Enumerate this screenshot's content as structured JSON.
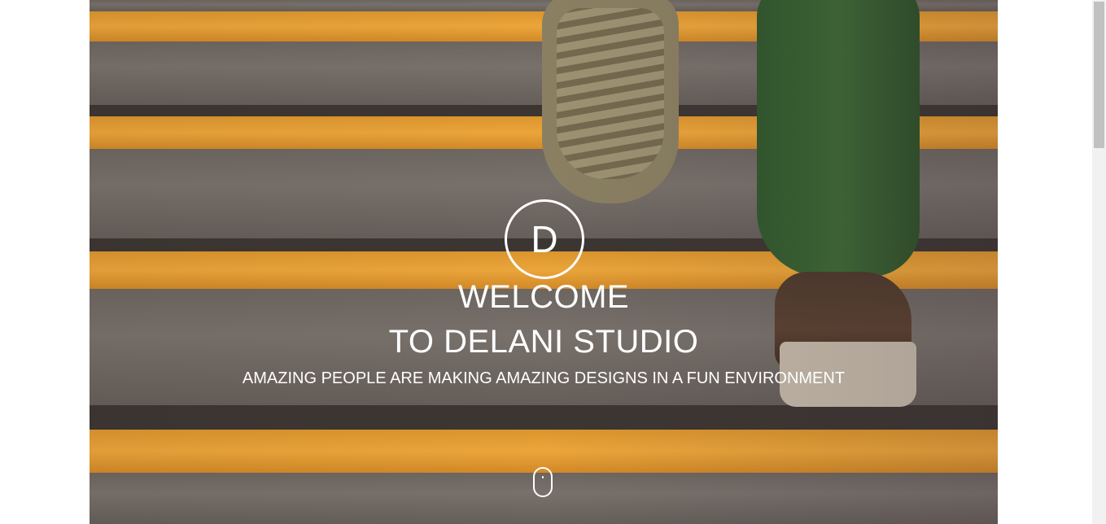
{
  "hero": {
    "logo_letter": "D",
    "title_line1": "WELCOME",
    "title_line2": "TO DELANI STUDIO",
    "tagline": "AMAZING PEOPLE ARE MAKING AMAZING DESIGNS IN A FUN ENVIRONMENT",
    "scroll_indicator": "mouse-scroll-icon"
  },
  "colors": {
    "accent_stair": "#f3ab3a",
    "text": "#ffffff",
    "page_background": "#ffffff"
  }
}
